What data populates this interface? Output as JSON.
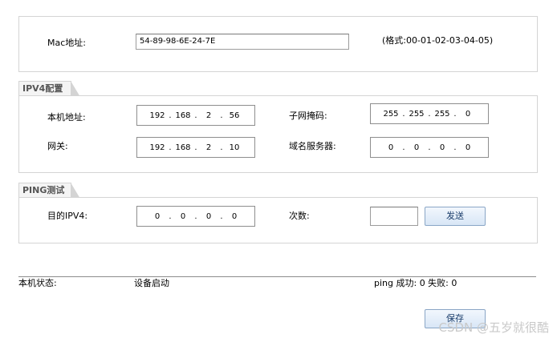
{
  "mac": {
    "label": "Mac地址:",
    "value": "54-89-98-6E-24-7E",
    "format_hint": "(格式:00-01-02-03-04-05)"
  },
  "ipv4": {
    "title": "IPV4配置",
    "local_addr_label": "本机地址:",
    "local_addr": [
      "192",
      "168",
      "2",
      "56"
    ],
    "subnet_label": "子网掩码:",
    "subnet": [
      "255",
      "255",
      "255",
      "0"
    ],
    "gateway_label": "网关:",
    "gateway": [
      "192",
      "168",
      "2",
      "10"
    ],
    "dns_label": "域名服务器:",
    "dns": [
      "0",
      "0",
      "0",
      "0"
    ]
  },
  "ping": {
    "title": "PING测试",
    "target_label": "目的IPV4:",
    "target": [
      "0",
      "0",
      "0",
      "0"
    ],
    "count_label": "次数:",
    "count_value": "",
    "send_label": "发送"
  },
  "status": {
    "label": "本机状态:",
    "value": "设备启动",
    "ping_result": "ping 成功: 0 失败: 0"
  },
  "footer": {
    "save_label": "保存",
    "watermark": "CSDN @五岁就很酷"
  }
}
